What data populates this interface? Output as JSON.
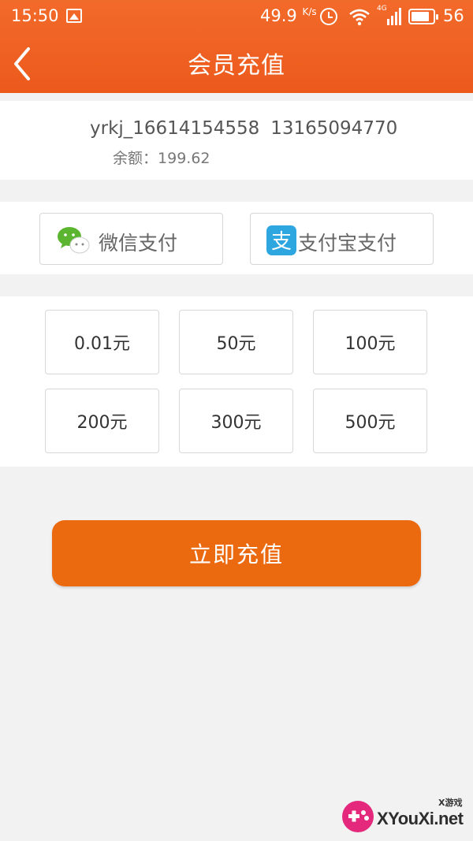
{
  "status_bar": {
    "time": "15:50",
    "net_speed": "49.9",
    "net_speed_unit": "K/s",
    "network_type": "4G",
    "battery": "56"
  },
  "header": {
    "title": "会员充值",
    "back_icon": "chevron-left-icon"
  },
  "account": {
    "username": "yrkj_16614154558",
    "phone": "13165094770",
    "balance_label": "余额：",
    "balance_value": "199.62"
  },
  "payment_methods": [
    {
      "label": "微信支付",
      "icon": "wechat-icon"
    },
    {
      "label": "支付宝支付",
      "icon": "alipay-icon"
    }
  ],
  "amounts": [
    "0.01元",
    "50元",
    "100元",
    "200元",
    "300元",
    "500元"
  ],
  "recharge_button": "立即充值",
  "watermark": {
    "text": "XYouXi.net",
    "sub": "X游戏"
  },
  "colors": {
    "header": "#ec5a1c",
    "button": "#eb6a10",
    "background": "#f2f2f2"
  }
}
